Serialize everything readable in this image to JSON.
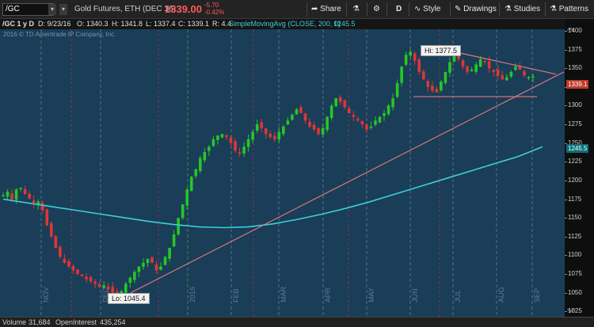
{
  "toolbar": {
    "symbol": "/GC",
    "description": "Gold Futures, ETH (DEC 16)",
    "last_price": "1339.00",
    "change": "-5.70",
    "change_pct": "-0.42%",
    "share_label": "Share",
    "period_label": "D",
    "style_label": "Style",
    "drawings_label": "Drawings",
    "studies_label": "Studies",
    "patterns_label": "Patterns"
  },
  "study_line": {
    "symbol_period": "/GC 1 y D",
    "date": "D: 9/23/16",
    "open": "O: 1340.3",
    "high": "H: 1341.8",
    "low": "L: 1337.4",
    "close": "C: 1339.1",
    "range": "R: 4.4",
    "study_name": "SimpleMovingAvg (CLOSE, 200, 0)",
    "study_value": "1245.5"
  },
  "chart": {
    "copyright": "2016 © TD Ameritrade IP Company, Inc.",
    "hi_label": "Hi: 1377.5",
    "lo_label": "Lo: 1045.4",
    "price_badge": "1339.1",
    "sma_badge": "1245.5",
    "colors": {
      "background": "#1a3d58",
      "up": "#26c726",
      "down": "#e03535",
      "sma": "#3ad0d8",
      "trendline": "#e07a7a"
    }
  },
  "chart_data": {
    "type": "candlestick",
    "y_ticks": [
      "1400",
      "1375",
      "1350",
      "1325",
      "1300",
      "1275",
      "1250",
      "1225",
      "1200",
      "1175",
      "1150",
      "1125",
      "1100",
      "1075",
      "1050",
      "1025"
    ],
    "ylim": [
      1018,
      1402
    ],
    "month_labels": [
      "NOV",
      "DEC",
      "2016",
      "FEB",
      "MAR",
      "APR",
      "MAY",
      "JUN",
      "JUL",
      "AUG",
      "SEP"
    ],
    "ohlc_path": [
      1180,
      1185,
      1175,
      1188,
      1190,
      1182,
      1176,
      1170,
      1172,
      1160,
      1140,
      1125,
      1110,
      1098,
      1090,
      1085,
      1080,
      1075,
      1072,
      1068,
      1065,
      1062,
      1058,
      1060,
      1055,
      1050,
      1048,
      1052,
      1062,
      1070,
      1078,
      1085,
      1090,
      1095,
      1090,
      1080,
      1085,
      1098,
      1110,
      1128,
      1150,
      1168,
      1188,
      1205,
      1215,
      1230,
      1238,
      1245,
      1255,
      1260,
      1262,
      1258,
      1250,
      1240,
      1236,
      1245,
      1255,
      1265,
      1275,
      1270,
      1262,
      1258,
      1255,
      1265,
      1272,
      1280,
      1288,
      1295,
      1290,
      1280,
      1272,
      1268,
      1262,
      1270,
      1285,
      1300,
      1310,
      1305,
      1298,
      1290,
      1285,
      1280,
      1275,
      1268,
      1272,
      1280,
      1285,
      1290,
      1300,
      1310,
      1330,
      1352,
      1368,
      1372,
      1360,
      1345,
      1335,
      1325,
      1320,
      1318,
      1332,
      1345,
      1358,
      1368,
      1362,
      1352,
      1345,
      1348,
      1355,
      1362,
      1358,
      1350,
      1345,
      1340,
      1335,
      1338,
      1345,
      1352,
      1348,
      1340,
      1338,
      1339
    ],
    "sma_200": [
      1175,
      1170,
      1165,
      1160,
      1155,
      1150,
      1145,
      1141,
      1138,
      1137,
      1138,
      1142,
      1148,
      1155,
      1163,
      1172,
      1182,
      1192,
      1202,
      1212,
      1222,
      1232,
      1245
    ],
    "support_trendline": {
      "from": {
        "x_label": "DEC",
        "y": 1050
      },
      "to": {
        "x_label": "SEP",
        "y": 1345
      }
    },
    "triangle_top": {
      "from_y": 1370,
      "to_y": 1342
    },
    "triangle_bottom": {
      "y": 1312
    },
    "hi": 1377.5,
    "lo": 1045.4
  },
  "bottom": {
    "volume_label": "Volume",
    "volume_value": "31,684",
    "oi_label": "OpenInterest",
    "oi_value": "435,254"
  }
}
